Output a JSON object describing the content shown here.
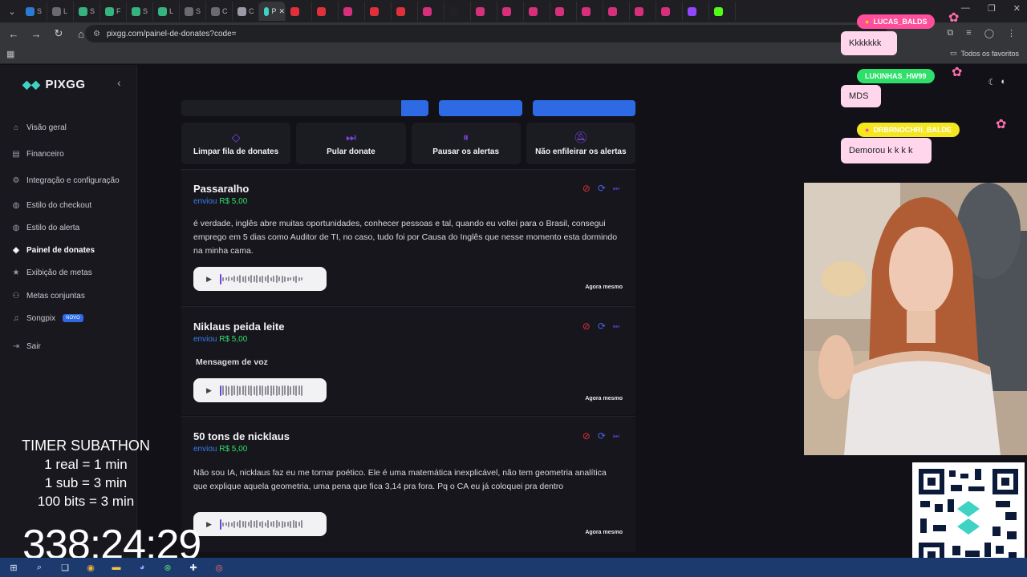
{
  "browser": {
    "url": "pixgg.com/painel-de-donates?code=",
    "bookmarks_label": "Todos os favoritos",
    "tab_labels": [
      "S",
      "L",
      "S",
      "F",
      "S",
      "L",
      "S",
      "C",
      "C",
      "P"
    ],
    "active_tab_label": "P"
  },
  "sidebar": {
    "logo": "PIXGG",
    "items": [
      {
        "label": "Visão geral"
      },
      {
        "label": "Financeiro"
      },
      {
        "label": "Integração e configuração"
      },
      {
        "label": "Estilo do checkout"
      },
      {
        "label": "Estilo do alerta"
      },
      {
        "label": "Painel de donates"
      },
      {
        "label": "Exibição de metas"
      },
      {
        "label": "Metas conjuntas"
      },
      {
        "label": "Songpix"
      },
      {
        "label": "Sair"
      }
    ],
    "novo_badge": "NOVO"
  },
  "actions": [
    {
      "label": "Limpar fila de donates",
      "icon": "eraser-icon"
    },
    {
      "label": "Pular donate",
      "icon": "skip-icon"
    },
    {
      "label": "Pausar os alertas",
      "icon": "pause-icon"
    },
    {
      "label": "Não enfileirar os alertas",
      "icon": "bell-off-icon"
    }
  ],
  "donations": [
    {
      "name": "Passaralho",
      "sent_label": "enviou",
      "amount": "R$ 5,00",
      "message": "é verdade, inglês abre muitas oportunidades, conhecer pessoas e tal, quando eu voltei para o Brasil, consegui emprego em 5 dias como Auditor de TI, no caso, tudo foi por Causa do Inglês que nesse momento esta dormindo na minha cama.",
      "time": "Agora mesmo"
    },
    {
      "name": "Niklaus peida leite",
      "sent_label": "enviou",
      "amount": "R$ 5,00",
      "message": "Mensagem de voz",
      "time": "Agora mesmo"
    },
    {
      "name": "50 tons de nicklaus",
      "sent_label": "enviou",
      "amount": "R$ 5,00",
      "message": "Não sou IA, nicklaus faz eu me tornar poético. Ele é uma matemática inexplicável, não tem geometria analítica que explique aquela geometria, uma pena que fica 3,14 pra fora. Pq o CA eu já coloquei pra dentro",
      "time": "Agora mesmo"
    }
  ],
  "overlay": {
    "timer_title": "TIMER SUBATHON",
    "timer_rules": [
      "1 real = 1 min",
      "1 sub = 3 min",
      "100 bits = 3 min"
    ],
    "timer_count": "338:24:29",
    "chat": [
      {
        "user": "LUCAS_BALDS",
        "message": "Kkkkkkk",
        "name_color": "#ff4f9a"
      },
      {
        "user": "LUKINHAS_HW99",
        "message": "MDS",
        "name_color": "#2ee06a"
      },
      {
        "user": "DRBRNOCHRI_BALDE",
        "message": "Demorou k k k k",
        "name_color": "#f5e61f"
      }
    ]
  },
  "colors": {
    "accent_purple": "#7b45e6",
    "brand_blue": "#2d6ae3",
    "amount_green": "#2ee06a",
    "danger_red": "#e0303a"
  }
}
